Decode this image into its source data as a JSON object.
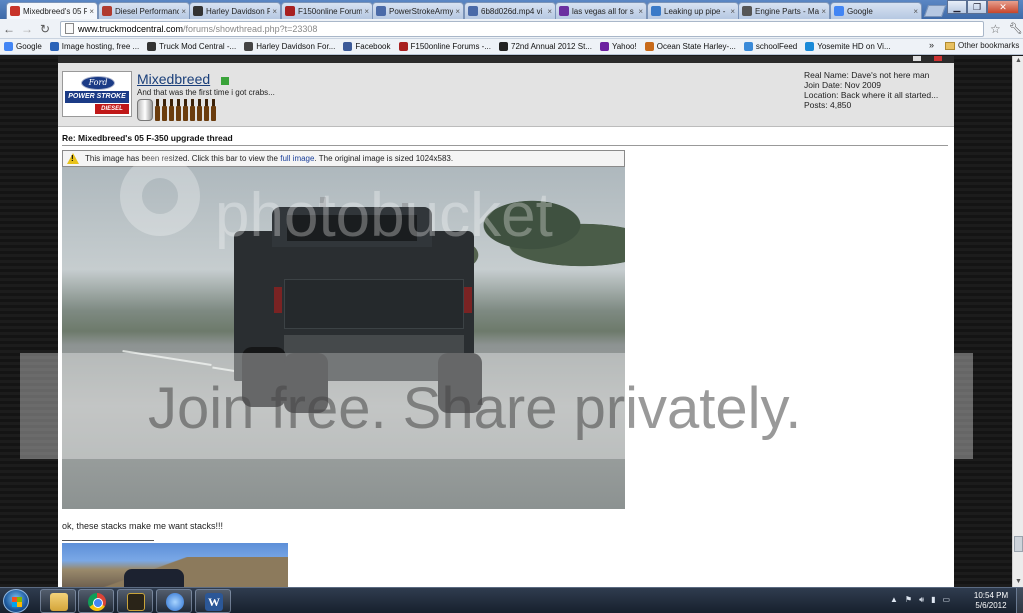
{
  "browser": {
    "tabs": [
      {
        "title": "Mixedbreed's 05 F",
        "active": true,
        "favicon_color": "#c7342a"
      },
      {
        "title": "Diesel Performanc",
        "active": false,
        "favicon_color": "#b03a2e"
      },
      {
        "title": "Harley Davidson F",
        "active": false,
        "favicon_color": "#333333"
      },
      {
        "title": "F150online Forum",
        "active": false,
        "favicon_color": "#a82020"
      },
      {
        "title": "PowerStrokeArmy",
        "active": false,
        "favicon_color": "#4a6aa8"
      },
      {
        "title": "6b8d026d.mp4 vi",
        "active": false,
        "favicon_color": "#4a6aa8"
      },
      {
        "title": "las vegas all for s",
        "active": false,
        "favicon_color": "#6b2fa0"
      },
      {
        "title": "Leaking up pipe -",
        "active": false,
        "favicon_color": "#3a7ac8"
      },
      {
        "title": "Engine Parts - Ma",
        "active": false,
        "favicon_color": "#555555"
      },
      {
        "title": "Google",
        "active": false,
        "favicon_color": "#4285f4"
      }
    ],
    "url_host": "www.truckmodcentral.com",
    "url_path": "/forums/showthread.php?t=23308",
    "bookmarks": [
      {
        "label": "Google",
        "color": "#4285f4"
      },
      {
        "label": "Image hosting, free ...",
        "color": "#2a62b8"
      },
      {
        "label": "Truck Mod Central -...",
        "color": "#333333"
      },
      {
        "label": "Harley Davidson For...",
        "color": "#444444"
      },
      {
        "label": "Facebook",
        "color": "#3b5998"
      },
      {
        "label": "F150online Forums -...",
        "color": "#a82020"
      },
      {
        "label": "72nd Annual 2012 St...",
        "color": "#222222"
      },
      {
        "label": "Yahoo!",
        "color": "#6b1fa0"
      },
      {
        "label": "Ocean State Harley-...",
        "color": "#c86a1a"
      },
      {
        "label": "schoolFeed",
        "color": "#3a8ad8"
      },
      {
        "label": "Yosemite HD on Vi...",
        "color": "#1a8ad8"
      }
    ],
    "other_bookmarks": "Other bookmarks"
  },
  "post": {
    "username": "Mixedbreed",
    "user_title": "And that was the first time i got crabs...",
    "info": {
      "real_name": "Real Name: Dave's not here man",
      "join_date": "Join Date: Nov 2009",
      "location": "Location: Back where it all started...",
      "posts": "Posts: 4,850"
    },
    "title": "Re: Mixedbreed's 05 F-350 upgrade thread",
    "resize_notice": {
      "before": "This image has been resized. Click this bar to view the",
      "link": "full image",
      "after": ". The original image is sized 1024x583."
    },
    "message": "ok, these stacks make me want stacks!!!"
  },
  "taskbar": {
    "time": "10:54 PM",
    "date": "5/6/2012"
  }
}
